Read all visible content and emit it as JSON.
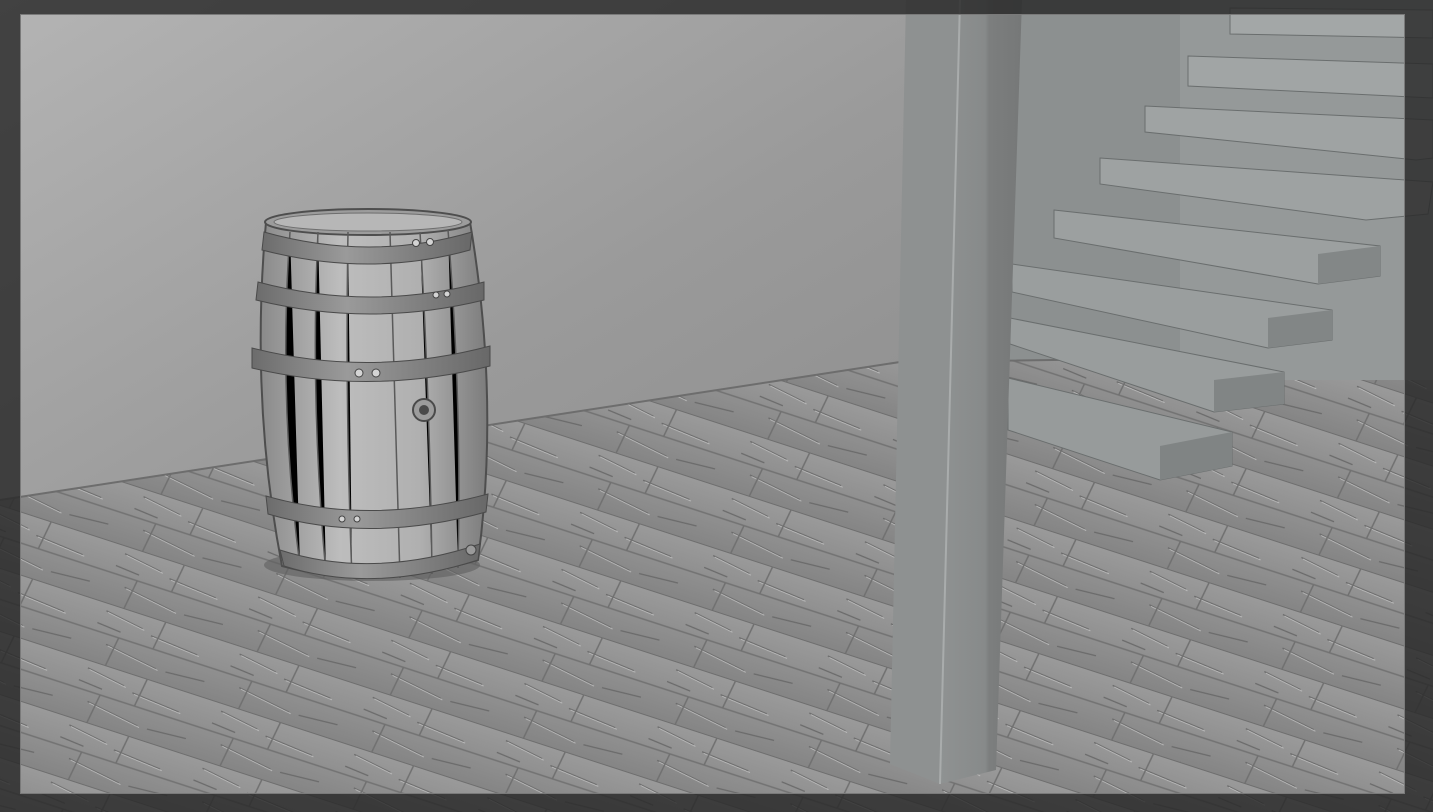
{
  "viewport": {
    "scene_objects": [
      "barrel",
      "floor-planks",
      "back-wall",
      "support-post",
      "staircase"
    ],
    "colors": {
      "wall": "#9c9c9c",
      "floor": "#8e8e8e",
      "barrel": "#a9a9a9",
      "band": "#7d7d7d",
      "post": "#8a8c8c",
      "stairs": "#8f9393",
      "frame_mask": "#2a2a2a"
    }
  }
}
